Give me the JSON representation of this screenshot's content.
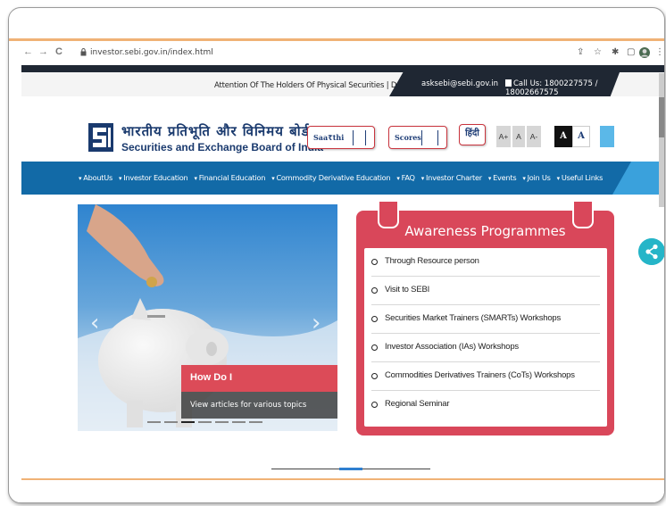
{
  "browser": {
    "url": "investor.sebi.gov.in/index.html",
    "back_icon": "arrow-left-icon",
    "forward_icon": "arrow-right-icon",
    "reload_icon": "reload-icon",
    "reload_glyph": "C",
    "back_glyph": "←",
    "forward_glyph": "→",
    "share_glyph": "⇪",
    "star_glyph": "☆",
    "ext_glyph": "✱",
    "tab_glyph": "▢",
    "menu_glyph": "⋮"
  },
  "infobar": {
    "marquee": "Attention Of The Holders Of Physical Securities  |  Detailed",
    "email": "asksebi@sebi.gov.in",
    "call": "Call Us: 1800227575 / 18002667575"
  },
  "logo": {
    "hindi": "भारतीय प्रतिभूति और विनिमय बोर्ड",
    "english": "Securities and Exchange Board of India"
  },
  "toolbar": {
    "saarthi_label": "Saa₹thi",
    "scores_label": "Scores",
    "hindi_label": "हिंदी",
    "font_increase": "A+",
    "font_normal": "A",
    "font_decrease": "A-",
    "contrast_dark": "A",
    "contrast_light": "A"
  },
  "menu": {
    "items": [
      "AboutUs",
      "Investor Education",
      "Financial Education",
      "Commodity Derivative Education",
      "FAQ",
      "Investor Charter",
      "Events",
      "Join Us",
      "Useful Links"
    ]
  },
  "slider": {
    "prev": "‹",
    "next": "›",
    "caption_title": "How Do I",
    "caption_sub": "View articles for various topics"
  },
  "awareness": {
    "title": "Awareness Programmes",
    "items": [
      "Through Resource person",
      "Visit to SEBI",
      "Securities Market Trainers (SMARTs) Workshops",
      "Investor Association (IAs) Workshops",
      "Commodities Derivatives Trainers (CoTs) Workshops",
      "Regional Seminar"
    ]
  },
  "colors": {
    "nav_blue": "#126aa7",
    "accent_red": "#d9475a",
    "dark": "#1f2733",
    "share_teal": "#25b5c8"
  }
}
